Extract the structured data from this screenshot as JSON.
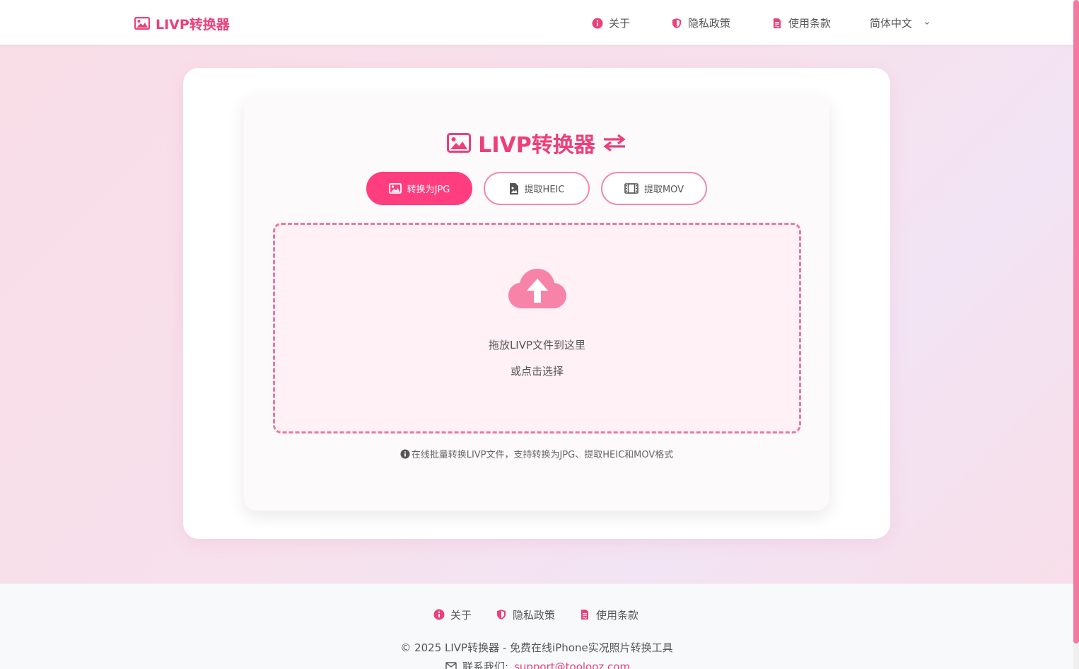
{
  "colors": {
    "accent": "#ec3f7b",
    "accent_bright": "#ff3d7f",
    "dropzone_border": "#ec7899"
  },
  "header": {
    "brand": "LIVP转换器",
    "nav": {
      "about": "关于",
      "privacy": "隐私政策",
      "terms": "使用条款",
      "language": "简体中文"
    }
  },
  "main": {
    "title": "LIVP转换器",
    "tabs": [
      {
        "label": "转换为JPG",
        "icon": "image-icon",
        "active": true
      },
      {
        "label": "提取HEIC",
        "icon": "file-image-icon",
        "active": false
      },
      {
        "label": "提取MOV",
        "icon": "film-icon",
        "active": false
      }
    ],
    "dropzone": {
      "title": "拖放LIVP文件到这里",
      "subtitle": "或点击选择",
      "icon": "cloud-upload-icon"
    },
    "info": "在线批量转换LIVP文件，支持转换为JPG、提取HEIC和MOV格式"
  },
  "footer": {
    "nav": {
      "about": "关于",
      "privacy": "隐私政策",
      "terms": "使用条款"
    },
    "copyright": "© 2025 LIVP转换器 - 免费在线iPhone实况照片转换工具",
    "contact_label": "联系我们:",
    "contact_email": "support@toolooz.com"
  }
}
